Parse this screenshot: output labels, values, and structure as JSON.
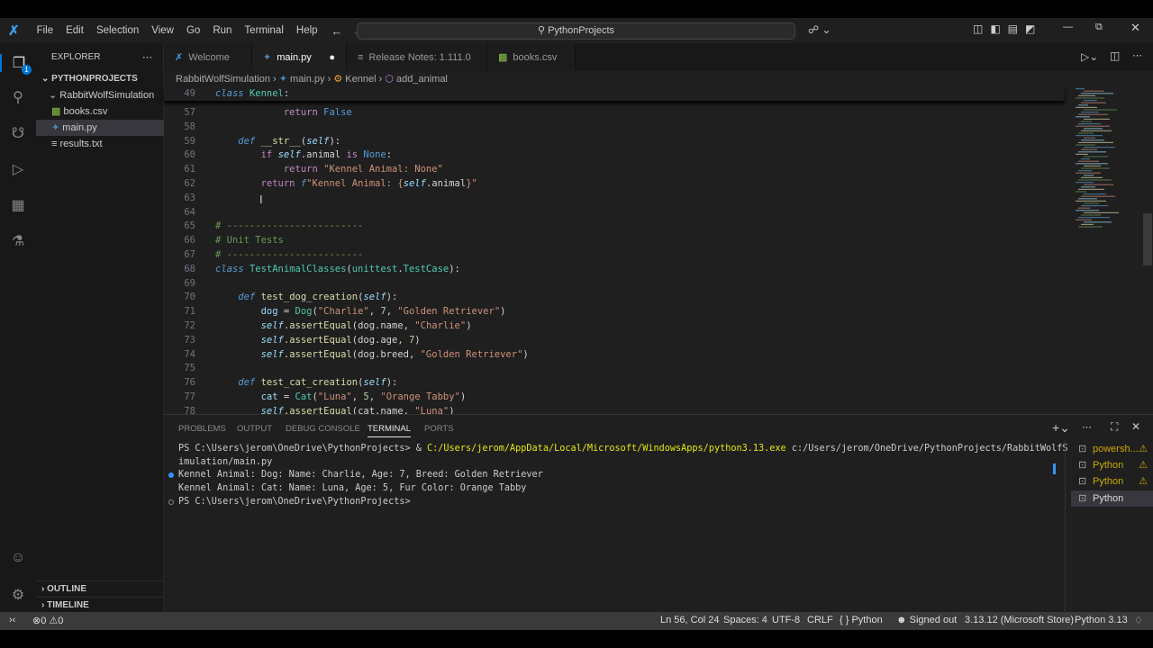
{
  "titlebar": {
    "menus": [
      "File",
      "Edit",
      "Selection",
      "View",
      "Go",
      "Run",
      "Terminal",
      "Help"
    ],
    "search": "PythonProjects"
  },
  "sidebar": {
    "title": "EXPLORER",
    "root": "PYTHONPROJECTS",
    "folder": "RabbitWolfSimulation",
    "files": [
      "books.csv",
      "main.py",
      "results.txt"
    ],
    "outline": "OUTLINE",
    "timeline": "TIMELINE",
    "badge": "1"
  },
  "tabs": [
    {
      "label": "Welcome"
    },
    {
      "label": "main.py",
      "dirty": true
    },
    {
      "label": "Release Notes: 1.111.0"
    },
    {
      "label": "books.csv"
    }
  ],
  "breadcrumb": [
    "RabbitWolfSimulation",
    "main.py",
    "Kennel",
    "add_animal"
  ],
  "code": {
    "sticky": {
      "n": "49",
      "t": [
        [
          "class",
          "kw"
        ],
        [
          " ",
          "pl"
        ],
        [
          "Kennel",
          "cls"
        ],
        [
          ":",
          "pl"
        ]
      ]
    },
    "lines": [
      {
        "n": "57",
        "t": [
          [
            "            ",
            "pl"
          ],
          [
            "return",
            "ret"
          ],
          [
            " ",
            "pl"
          ],
          [
            "False",
            "const"
          ]
        ]
      },
      {
        "n": "58",
        "t": []
      },
      {
        "n": "59",
        "t": [
          [
            "    ",
            "pl"
          ],
          [
            "def",
            "kw"
          ],
          [
            " ",
            "pl"
          ],
          [
            "__str__",
            "fn"
          ],
          [
            "(",
            "pl"
          ],
          [
            "self",
            "slf"
          ],
          [
            "):",
            "pl"
          ]
        ]
      },
      {
        "n": "60",
        "t": [
          [
            "        ",
            "pl"
          ],
          [
            "if",
            "ctl"
          ],
          [
            " ",
            "pl"
          ],
          [
            "self",
            "slf"
          ],
          [
            ".animal ",
            "pl"
          ],
          [
            "is",
            "ctl"
          ],
          [
            " ",
            "pl"
          ],
          [
            "None",
            "const"
          ],
          [
            ":",
            "pl"
          ]
        ]
      },
      {
        "n": "61",
        "t": [
          [
            "            ",
            "pl"
          ],
          [
            "return",
            "ret"
          ],
          [
            " ",
            "pl"
          ],
          [
            "\"Kennel Animal: None\"",
            "str"
          ]
        ]
      },
      {
        "n": "62",
        "t": [
          [
            "        ",
            "pl"
          ],
          [
            "return",
            "ret"
          ],
          [
            " ",
            "pl"
          ],
          [
            "f",
            "kw"
          ],
          [
            "\"Kennel Animal: {",
            "str"
          ],
          [
            "self",
            "slf"
          ],
          [
            ".animal",
            "pl"
          ],
          [
            "}\"",
            "str"
          ]
        ]
      },
      {
        "n": "63",
        "t": []
      },
      {
        "n": "64",
        "t": []
      },
      {
        "n": "65",
        "t": [
          [
            "# ------------------------",
            "cmt"
          ]
        ]
      },
      {
        "n": "66",
        "t": [
          [
            "# Unit Tests",
            "cmt"
          ]
        ]
      },
      {
        "n": "67",
        "t": [
          [
            "# ------------------------",
            "cmt"
          ]
        ]
      },
      {
        "n": "68",
        "t": [
          [
            "class",
            "kw"
          ],
          [
            " ",
            "pl"
          ],
          [
            "TestAnimalClasses",
            "cls"
          ],
          [
            "(",
            "pl"
          ],
          [
            "unittest",
            "cls"
          ],
          [
            ".",
            "pl"
          ],
          [
            "TestCase",
            "cls"
          ],
          [
            "):",
            "pl"
          ]
        ]
      },
      {
        "n": "69",
        "t": []
      },
      {
        "n": "70",
        "t": [
          [
            "    ",
            "pl"
          ],
          [
            "def",
            "kw"
          ],
          [
            " ",
            "pl"
          ],
          [
            "test_dog_creation",
            "fn"
          ],
          [
            "(",
            "pl"
          ],
          [
            "self",
            "slf"
          ],
          [
            "):",
            "pl"
          ]
        ]
      },
      {
        "n": "71",
        "t": [
          [
            "        ",
            "pl"
          ],
          [
            "dog",
            "var"
          ],
          [
            " = ",
            "pl"
          ],
          [
            "Dog",
            "cls"
          ],
          [
            "(",
            "pl"
          ],
          [
            "\"Charlie\"",
            "str"
          ],
          [
            ", ",
            "pl"
          ],
          [
            "7",
            "num"
          ],
          [
            ", ",
            "pl"
          ],
          [
            "\"Golden Retriever\"",
            "str"
          ],
          [
            ")",
            "pl"
          ]
        ]
      },
      {
        "n": "72",
        "t": [
          [
            "        ",
            "pl"
          ],
          [
            "self",
            "slf"
          ],
          [
            ".",
            "pl"
          ],
          [
            "assertEqual",
            "fn"
          ],
          [
            "(dog.name, ",
            "pl"
          ],
          [
            "\"Charlie\"",
            "str"
          ],
          [
            ")",
            "pl"
          ]
        ]
      },
      {
        "n": "73",
        "t": [
          [
            "        ",
            "pl"
          ],
          [
            "self",
            "slf"
          ],
          [
            ".",
            "pl"
          ],
          [
            "assertEqual",
            "fn"
          ],
          [
            "(dog.age, ",
            "pl"
          ],
          [
            "7",
            "num"
          ],
          [
            ")",
            "pl"
          ]
        ]
      },
      {
        "n": "74",
        "t": [
          [
            "        ",
            "pl"
          ],
          [
            "self",
            "slf"
          ],
          [
            ".",
            "pl"
          ],
          [
            "assertEqual",
            "fn"
          ],
          [
            "(dog.breed, ",
            "pl"
          ],
          [
            "\"Golden Retriever\"",
            "str"
          ],
          [
            ")",
            "pl"
          ]
        ]
      },
      {
        "n": "75",
        "t": []
      },
      {
        "n": "76",
        "t": [
          [
            "    ",
            "pl"
          ],
          [
            "def",
            "kw"
          ],
          [
            " ",
            "pl"
          ],
          [
            "test_cat_creation",
            "fn"
          ],
          [
            "(",
            "pl"
          ],
          [
            "self",
            "slf"
          ],
          [
            "):",
            "pl"
          ]
        ]
      },
      {
        "n": "77",
        "t": [
          [
            "        ",
            "pl"
          ],
          [
            "cat",
            "var"
          ],
          [
            " = ",
            "pl"
          ],
          [
            "Cat",
            "cls"
          ],
          [
            "(",
            "pl"
          ],
          [
            "\"Luna\"",
            "str"
          ],
          [
            ", ",
            "pl"
          ],
          [
            "5",
            "num"
          ],
          [
            ", ",
            "pl"
          ],
          [
            "\"Orange Tabby\"",
            "str"
          ],
          [
            ")",
            "pl"
          ]
        ]
      },
      {
        "n": "78",
        "t": [
          [
            "        ",
            "pl"
          ],
          [
            "self",
            "slf"
          ],
          [
            ".",
            "pl"
          ],
          [
            "assertEqual",
            "fn"
          ],
          [
            "(cat.name, ",
            "pl"
          ],
          [
            "\"Luna\"",
            "str"
          ],
          [
            ")",
            "pl"
          ]
        ]
      }
    ]
  },
  "panel": {
    "tabs": [
      "PROBLEMS",
      "OUTPUT",
      "DEBUG CONSOLE",
      "TERMINAL",
      "PORTS"
    ],
    "terminal": {
      "cmd_prompt": "PS C:\\Users\\jerom\\OneDrive\\PythonProjects> & ",
      "cmd_exe": "C:/Users/jerom/AppData/Local/Microsoft/WindowsApps/python3.13.exe",
      "cmd_arg": " c:/Users/jerom/OneDrive/PythonProjects/RabbitWolfS",
      "cmd_wrap": "imulation/main.py",
      "out1": "Kennel Animal: Dog: Name: Charlie, Age: 7, Breed: Golden Retriever",
      "out2": "Kennel Animal: Cat: Name: Luna, Age: 5, Fur Color: Orange Tabby",
      "prompt": "PS C:\\Users\\jerom\\OneDrive\\PythonProjects>"
    },
    "terminals": [
      "powersh...",
      "Python",
      "Python",
      "Python"
    ]
  },
  "status": {
    "errors": "0",
    "warnings": "0",
    "position": "Ln 56, Col 24",
    "spaces": "Spaces: 4",
    "encoding": "UTF-8",
    "eol": "CRLF",
    "language": "Python",
    "account": "Signed out",
    "interpreter": "3.13.12 (Microsoft Store)",
    "version": "Python 3.13"
  }
}
